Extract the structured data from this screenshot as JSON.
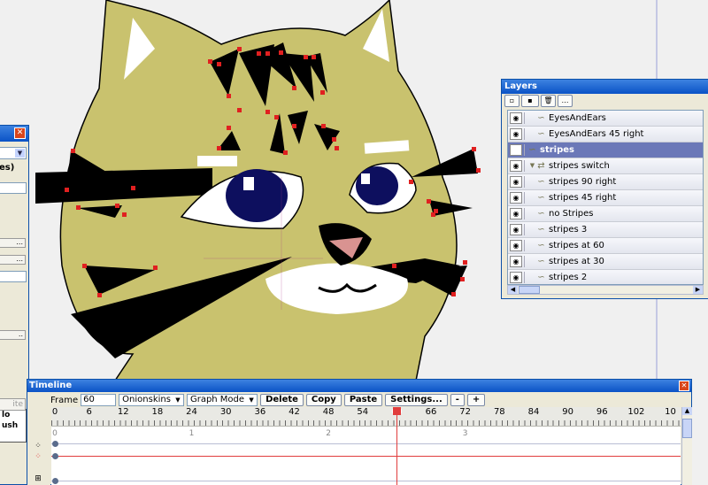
{
  "layers_panel": {
    "title": "Layers",
    "toolbar_buttons": [
      "new-layer-icon",
      "new-switch-icon",
      "delete-icon",
      "more-icon"
    ],
    "layers": [
      {
        "label": "EyesAndEars",
        "indent": 1,
        "type": "vector",
        "selected": false
      },
      {
        "label": "EyesAndEars 45 right",
        "indent": 1,
        "type": "vector",
        "selected": false
      },
      {
        "label": "stripes",
        "indent": 0,
        "type": "vector",
        "selected": true
      },
      {
        "label": "stripes switch",
        "indent": 0,
        "type": "switch",
        "selected": false,
        "expanded": true
      },
      {
        "label": "stripes 90 right",
        "indent": 1,
        "type": "vector",
        "selected": false
      },
      {
        "label": "stripes 45 right",
        "indent": 1,
        "type": "vector",
        "selected": false
      },
      {
        "label": "no Stripes",
        "indent": 1,
        "type": "vector",
        "selected": false
      },
      {
        "label": "stripes 3",
        "indent": 1,
        "type": "vector",
        "selected": false
      },
      {
        "label": "stripes at 60",
        "indent": 1,
        "type": "vector",
        "selected": false
      },
      {
        "label": "stripes at 30",
        "indent": 1,
        "type": "vector",
        "selected": false
      },
      {
        "label": "stripes 2",
        "indent": 1,
        "type": "vector",
        "selected": false
      }
    ]
  },
  "timeline": {
    "title": "Timeline",
    "frame_label": "Frame",
    "frame_value": "60",
    "onionskins_label": "Onionskins",
    "graph_mode_label": "Graph Mode",
    "buttons": {
      "delete": "Delete",
      "copy": "Copy",
      "paste": "Paste",
      "settings": "Settings...",
      "minus": "-",
      "plus": "+"
    },
    "ruler_ticks": [
      "0",
      "6",
      "12",
      "18",
      "24",
      "30",
      "36",
      "42",
      "48",
      "54",
      "60",
      "66",
      "72",
      "78",
      "84",
      "90",
      "96",
      "102",
      "10"
    ],
    "current_frame": 60,
    "keyframe_labels": [
      "0",
      "1",
      "2",
      "3"
    ]
  },
  "left_panel": {
    "fragment_text_1": "es)",
    "fragment_text_2": "lo",
    "fragment_text_3": "ush",
    "fragment_button": "ite"
  },
  "colors": {
    "cat_fur": "#c9c26e",
    "eye_iris": "#0d0f5e",
    "nose": "#d99391",
    "handle": "#e02020",
    "selected_layer": "#6b78b8",
    "title_bar": "#0a52c6",
    "playhead": "#e13d3d"
  }
}
